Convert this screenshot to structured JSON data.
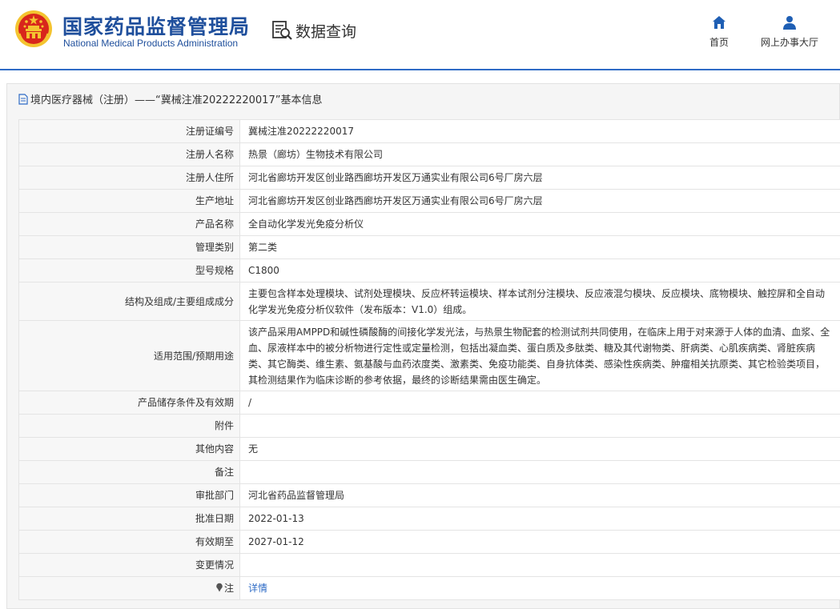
{
  "header": {
    "site_title": "国家药品监督管理局",
    "site_subtitle": "National Medical Products Administration",
    "query_title": "数据查询",
    "emblem_icon": "national-emblem-icon",
    "query_icon": "data-search-icon",
    "nav": [
      {
        "label": "首页",
        "icon": "home-icon"
      },
      {
        "label": "网上办事大厅",
        "icon": "user-icon"
      }
    ]
  },
  "breadcrumb": {
    "text": "境内医疗器械（注册）——“冀械注准20222220017”基本信息",
    "icon": "document-icon"
  },
  "records": [
    {
      "label": "注册证编号",
      "value": "冀械注准20222220017"
    },
    {
      "label": "注册人名称",
      "value": "热景（廊坊）生物技术有限公司"
    },
    {
      "label": "注册人住所",
      "value": "河北省廊坊开发区创业路西廊坊开发区万通实业有限公司6号厂房六层"
    },
    {
      "label": "生产地址",
      "value": "河北省廊坊开发区创业路西廊坊开发区万通实业有限公司6号厂房六层"
    },
    {
      "label": "产品名称",
      "value": "全自动化学发光免疫分析仪"
    },
    {
      "label": "管理类别",
      "value": "第二类"
    },
    {
      "label": "型号规格",
      "value": "C1800"
    },
    {
      "label": "结构及组成/主要组成成分",
      "value": "主要包含样本处理模块、试剂处理模块、反应杯转运模块、样本试剂分注模块、反应液混匀模块、反应模块、底物模块、触控屏和全自动化学发光免疫分析仪软件（发布版本：V1.0）组成。"
    },
    {
      "label": "适用范围/预期用途",
      "value": "该产品采用AMPPD和碱性磷酸酶的间接化学发光法，与热景生物配套的检测试剂共同使用，在临床上用于对来源于人体的血清、血浆、全血、尿液样本中的被分析物进行定性或定量检测，包括出凝血类、蛋白质及多肽类、糖及其代谢物类、肝病类、心肌疾病类、肾脏疾病类、其它酶类、维生素、氨基酸与血药浓度类、激素类、免疫功能类、自身抗体类、感染性疾病类、肿瘤相关抗原类、其它检验类项目，其检测结果作为临床诊断的参考依据，最终的诊断结果需由医生确定。"
    },
    {
      "label": "产品储存条件及有效期",
      "value": "/"
    },
    {
      "label": "附件",
      "value": ""
    },
    {
      "label": "其他内容",
      "value": "无"
    },
    {
      "label": "备注",
      "value": ""
    },
    {
      "label": "审批部门",
      "value": "河北省药品监督管理局"
    },
    {
      "label": "批准日期",
      "value": "2022-01-13"
    },
    {
      "label": "有效期至",
      "value": "2027-01-12"
    },
    {
      "label": "变更情况",
      "value": ""
    }
  ],
  "note_row": {
    "label": "注",
    "icon": "pin-icon",
    "link_text": "详情"
  },
  "colors": {
    "brand_blue": "#1f4f9c",
    "link_blue": "#2e6bc6",
    "emblem_red": "#d8261c",
    "emblem_gold": "#f4c430"
  }
}
